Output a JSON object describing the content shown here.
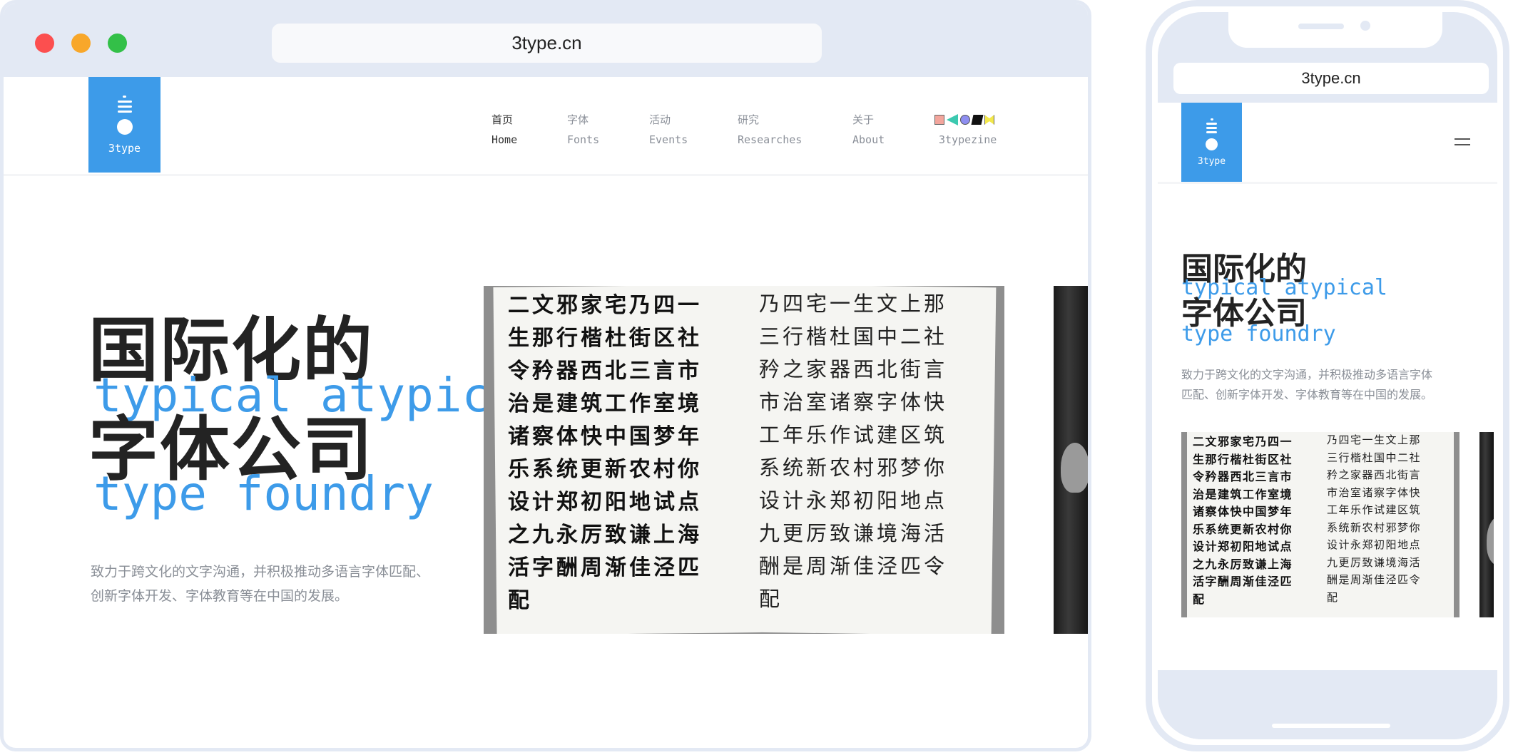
{
  "desktop": {
    "url": "3type.cn",
    "logo_text": "3type",
    "nav": [
      {
        "zh": "首页",
        "en": "Home",
        "active": true
      },
      {
        "zh": "字体",
        "en": "Fonts",
        "active": false
      },
      {
        "zh": "活动",
        "en": "Events",
        "active": false
      },
      {
        "zh": "研究",
        "en": "Researches",
        "active": false
      },
      {
        "zh": "关于",
        "en": "About",
        "active": false
      }
    ],
    "zine_label": "3typezine",
    "zine_icons": [
      "square-icon",
      "triangle-icon",
      "circle-icon",
      "parallelogram-icon",
      "bowtie-icon"
    ],
    "hero": {
      "zh_line1": "国际化的",
      "en_line1": "typical atypical",
      "zh_line2": "字体公司",
      "en_line2": "type foundry",
      "desc_line1": "致力于跨文化的文字沟通，并积极推动多语言字体匹配、",
      "desc_line2": "创新字体开发、字体教育等在中国的发展。"
    },
    "specimen": {
      "left_rows": [
        "二文邪家宅乃四一",
        "生那行楷杜街区社",
        "令矜器西北三言市",
        "治是建筑工作室境",
        "诸察体快中国梦年",
        "乐系统更新农村你",
        "设计郑初阳地试点",
        "之九永厉致谦上海",
        "活字酬周渐佳泾匹",
        "配"
      ],
      "right_rows": [
        "乃四宅一生文上那",
        "三行楷杜国中二社",
        "矜之家器西北街言",
        "市治室诸察字体快",
        "工年乐作试建区筑",
        "系统新农村邪梦你",
        "设计永郑初阳地点",
        "九更厉致谦境海活",
        "酬是周渐佳泾匹令",
        "配"
      ]
    }
  },
  "phone": {
    "url": "3type.cn",
    "logo_text": "3type",
    "hero": {
      "zh_line1": "国际化的",
      "en_line1": "typical atypical",
      "zh_line2": "字体公司",
      "en_line2": "type foundry",
      "desc_line1": "致力于跨文化的文字沟通，并积极推动多语言字体",
      "desc_line2": "匹配、创新字体开发、字体教育等在中国的发展。"
    }
  },
  "colors": {
    "frame": "#e3e9f4",
    "accent_blue": "#3d9be9",
    "heading": "#232323",
    "muted": "#8a8f97"
  }
}
